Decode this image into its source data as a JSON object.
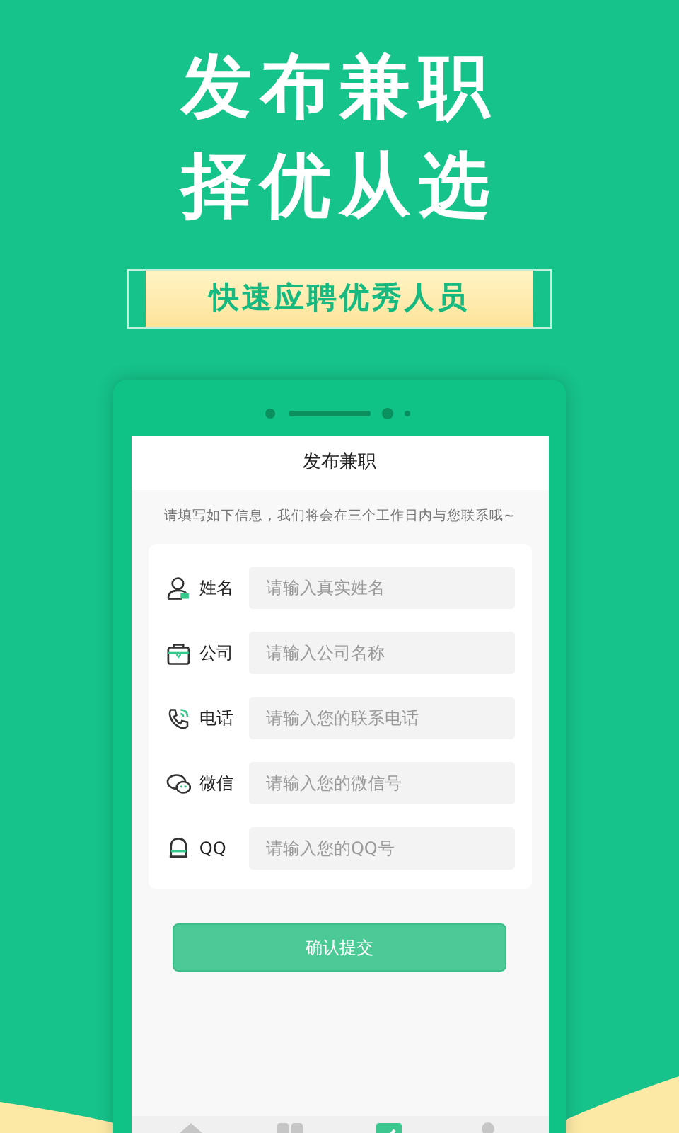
{
  "headline": [
    "发布兼职",
    "择优从选"
  ],
  "banner": "快速应聘优秀人员",
  "screen": {
    "title": "发布兼职",
    "notice": "请填写如下信息，我们将会在三个工作日内与您联系哦~",
    "fields": [
      {
        "kind": "person",
        "label": "姓名",
        "placeholder": "请输入真实姓名"
      },
      {
        "kind": "briefcase",
        "label": "公司",
        "placeholder": "请输入公司名称"
      },
      {
        "kind": "phone",
        "label": "电话",
        "placeholder": "请输入您的联系电话"
      },
      {
        "kind": "chat",
        "label": "微信",
        "placeholder": "请输入您的微信号"
      },
      {
        "kind": "penguin",
        "label": "QQ",
        "placeholder": "请输入您的QQ号"
      }
    ],
    "submit": "确认提交",
    "tabs": [
      {
        "kind": "home",
        "selected": false
      },
      {
        "kind": "grid",
        "selected": false
      },
      {
        "kind": "edit",
        "selected": true
      },
      {
        "kind": "user",
        "selected": false
      }
    ]
  }
}
